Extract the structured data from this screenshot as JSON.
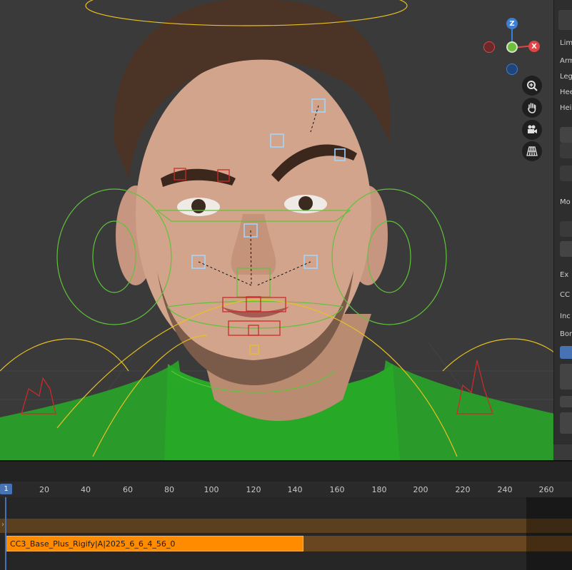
{
  "gizmo": {
    "z_label": "Z",
    "x_label": "X",
    "colors": {
      "x": "#e04545",
      "y": "#6fbf3c",
      "z": "#3d7fd6"
    }
  },
  "viewport_tools": [
    "zoom-icon",
    "pan-hand-icon",
    "camera-icon",
    "grid-perspective-icon"
  ],
  "side_panel": {
    "labels": [
      "Lim",
      "Arm",
      "Leg",
      "Hee",
      "Hei",
      "Mo",
      "Ex",
      "CC",
      "Inc",
      "Bor"
    ]
  },
  "timeline": {
    "current_frame": "1",
    "ticks": [
      "20",
      "40",
      "60",
      "80",
      "100",
      "120",
      "140",
      "160",
      "180",
      "200",
      "220",
      "240",
      "260"
    ],
    "strip_label": "CC3_Base_Plus_Rigify|A|2025_6_6_4_56_0"
  }
}
